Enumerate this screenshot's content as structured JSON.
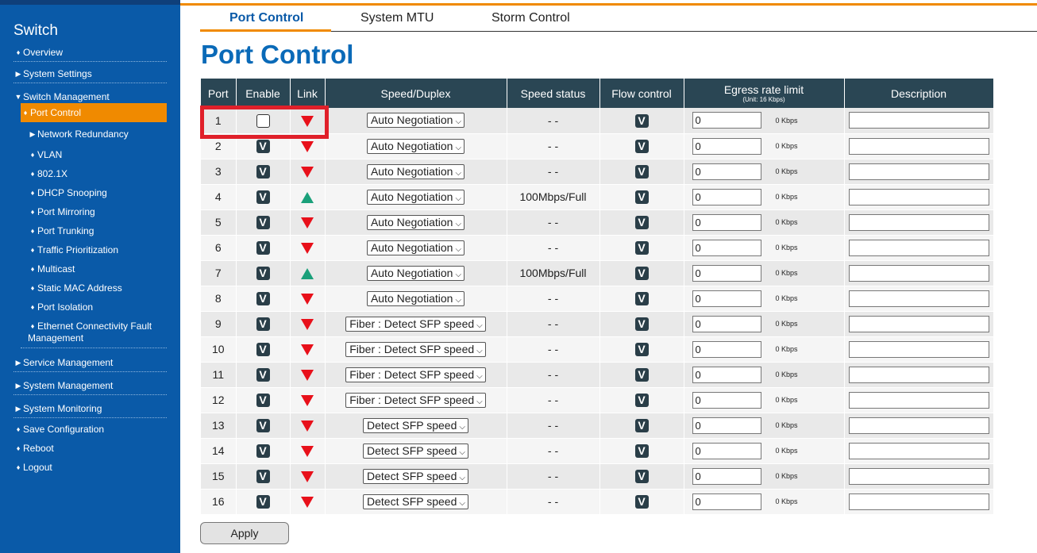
{
  "sidebar": {
    "title": "Switch",
    "items": [
      {
        "label": "Overview",
        "marker": "♦"
      },
      {
        "label": "System Settings",
        "marker": "▶"
      },
      {
        "label": "Switch Management",
        "marker": "▼"
      },
      {
        "label": "Port Control",
        "marker": "♦"
      },
      {
        "label": "Network Redundancy",
        "marker": "▶"
      },
      {
        "label": "VLAN",
        "marker": "♦"
      },
      {
        "label": "802.1X",
        "marker": "♦"
      },
      {
        "label": "DHCP Snooping",
        "marker": "♦"
      },
      {
        "label": "Port Mirroring",
        "marker": "♦"
      },
      {
        "label": "Port Trunking",
        "marker": "♦"
      },
      {
        "label": "Traffic Prioritization",
        "marker": "♦"
      },
      {
        "label": "Multicast",
        "marker": "♦"
      },
      {
        "label": "Static MAC Address",
        "marker": "♦"
      },
      {
        "label": "Port Isolation",
        "marker": "♦"
      },
      {
        "label": "Ethernet Connectivity Fault",
        "label2": "Management",
        "marker": "♦"
      },
      {
        "label": "Service Management",
        "marker": "▶"
      },
      {
        "label": "System Management",
        "marker": "▶"
      },
      {
        "label": "System Monitoring",
        "marker": "▶"
      },
      {
        "label": "Save Configuration",
        "marker": "♦"
      },
      {
        "label": "Reboot",
        "marker": "♦"
      },
      {
        "label": "Logout",
        "marker": "♦"
      }
    ]
  },
  "tabs": [
    {
      "label": "Port Control"
    },
    {
      "label": "System MTU"
    },
    {
      "label": "Storm Control"
    }
  ],
  "page_title": "Port Control",
  "table": {
    "headers": {
      "port": "Port",
      "enable": "Enable",
      "link": "Link",
      "speed_duplex": "Speed/Duplex",
      "speed_status": "Speed status",
      "flow_control": "Flow control",
      "egress": "Egress rate limit",
      "egress_unit": "(Unit: 16 Kbps)",
      "description": "Description"
    },
    "check_glyph": "V",
    "kbps_label": "0 Kbps",
    "rows": [
      {
        "port": "1",
        "enabled": false,
        "link": "down",
        "speed": "Auto Negotiation",
        "status": "- -",
        "egress": "0"
      },
      {
        "port": "2",
        "enabled": true,
        "link": "down",
        "speed": "Auto Negotiation",
        "status": "- -",
        "egress": "0"
      },
      {
        "port": "3",
        "enabled": true,
        "link": "down",
        "speed": "Auto Negotiation",
        "status": "- -",
        "egress": "0"
      },
      {
        "port": "4",
        "enabled": true,
        "link": "up",
        "speed": "Auto Negotiation",
        "status": "100Mbps/Full",
        "egress": "0"
      },
      {
        "port": "5",
        "enabled": true,
        "link": "down",
        "speed": "Auto Negotiation",
        "status": "- -",
        "egress": "0"
      },
      {
        "port": "6",
        "enabled": true,
        "link": "down",
        "speed": "Auto Negotiation",
        "status": "- -",
        "egress": "0"
      },
      {
        "port": "7",
        "enabled": true,
        "link": "up",
        "speed": "Auto Negotiation",
        "status": "100Mbps/Full",
        "egress": "0"
      },
      {
        "port": "8",
        "enabled": true,
        "link": "down",
        "speed": "Auto Negotiation",
        "status": "- -",
        "egress": "0"
      },
      {
        "port": "9",
        "enabled": true,
        "link": "down",
        "speed": "Fiber : Detect SFP speed",
        "status": "- -",
        "egress": "0"
      },
      {
        "port": "10",
        "enabled": true,
        "link": "down",
        "speed": "Fiber : Detect SFP speed",
        "status": "- -",
        "egress": "0"
      },
      {
        "port": "11",
        "enabled": true,
        "link": "down",
        "speed": "Fiber : Detect SFP speed",
        "status": "- -",
        "egress": "0"
      },
      {
        "port": "12",
        "enabled": true,
        "link": "down",
        "speed": "Fiber : Detect SFP speed",
        "status": "- -",
        "egress": "0"
      },
      {
        "port": "13",
        "enabled": true,
        "link": "down",
        "speed": "Detect SFP speed",
        "status": "- -",
        "egress": "0"
      },
      {
        "port": "14",
        "enabled": true,
        "link": "down",
        "speed": "Detect SFP speed",
        "status": "- -",
        "egress": "0"
      },
      {
        "port": "15",
        "enabled": true,
        "link": "down",
        "speed": "Detect SFP speed",
        "status": "- -",
        "egress": "0"
      },
      {
        "port": "16",
        "enabled": true,
        "link": "down",
        "speed": "Detect SFP speed",
        "status": "- -",
        "egress": "0"
      }
    ]
  },
  "apply_label": "Apply",
  "colors": {
    "sidebar_bg": "#0a5aa8",
    "accent": "#f08a00",
    "header_bg": "#2a4654",
    "link_up": "#1aa07a",
    "link_down": "#e8101a",
    "highlight": "#e0202a"
  }
}
